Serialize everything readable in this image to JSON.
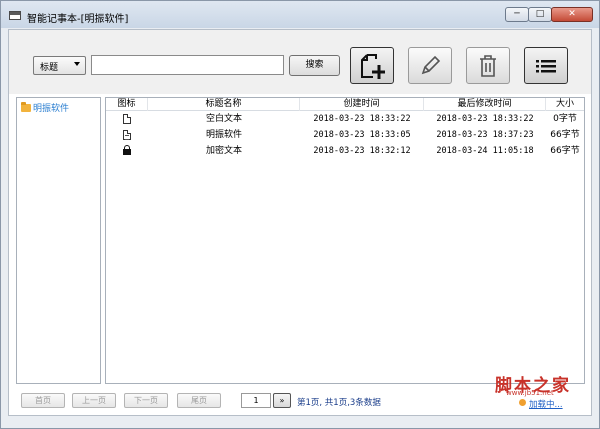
{
  "window": {
    "title": "智能记事本-[明振软件]",
    "controls": {
      "minimize": "─",
      "maximize": "□",
      "close": "✕"
    }
  },
  "toolbar": {
    "field_select": "标题",
    "search_placeholder": "",
    "search_value": "",
    "search_button": "搜索",
    "icons": [
      "new-document-icon",
      "edit-pencil-icon",
      "trash-icon",
      "list-icon"
    ]
  },
  "tree": {
    "items": [
      {
        "label": "明振软件",
        "icon": "folder-icon"
      }
    ]
  },
  "table": {
    "columns": [
      "图标",
      "标题名称",
      "创建时间",
      "最后修改时间",
      "大小"
    ],
    "rows": [
      {
        "icon": "blank-document-icon",
        "title": "空白文本",
        "created": "2018-03-23 18:33:22",
        "modified": "2018-03-23 18:33:22",
        "size": "0字节"
      },
      {
        "icon": "text-document-icon",
        "title": "明振软件",
        "created": "2018-03-23 18:33:05",
        "modified": "2018-03-23 18:37:23",
        "size": "66字节"
      },
      {
        "icon": "lock-icon",
        "title": "加密文本",
        "created": "2018-03-23 18:32:12",
        "modified": "2018-03-24 11:05:18",
        "size": "66字节"
      }
    ]
  },
  "pager": {
    "first": "首页",
    "prev": "上一页",
    "next": "下一页",
    "last": "尾页",
    "page_value": "1",
    "go": "»",
    "info": "第1页, 共1页,3条数据"
  },
  "watermark": {
    "logo": "脚本之家",
    "url": "www.jb51.net"
  },
  "status": {
    "loading": "加载中..."
  },
  "colors": {
    "accent": "#2a7ed0",
    "folder": "#f2b33d",
    "link": "#1e5fc5",
    "watermark_red": "#c8322a"
  }
}
